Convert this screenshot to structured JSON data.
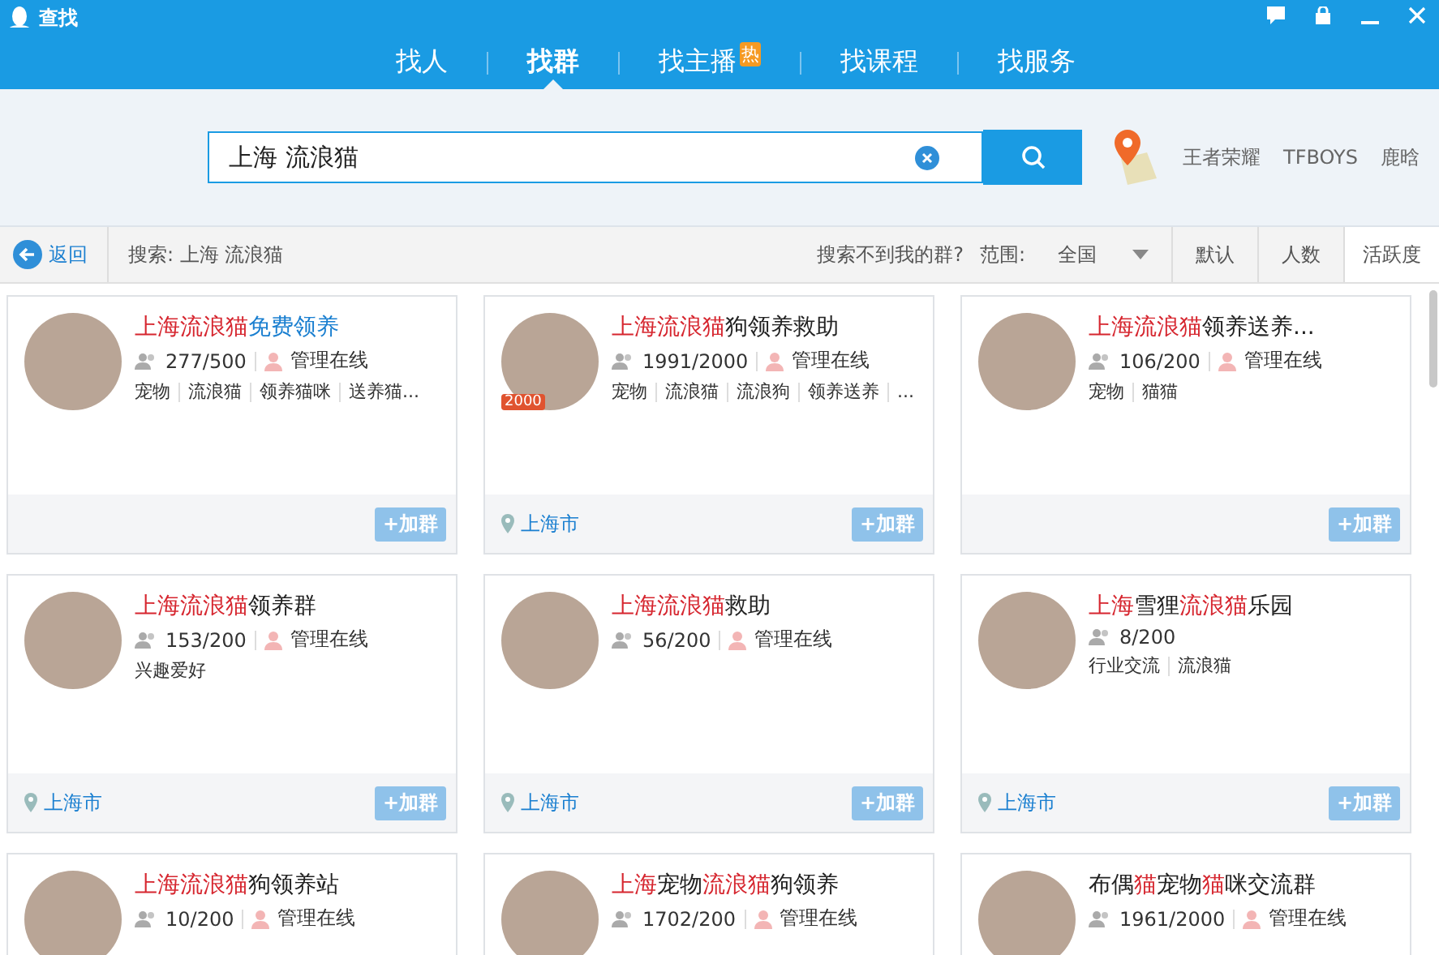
{
  "window": {
    "title": "查找"
  },
  "nav_tabs": [
    {
      "label": "找人",
      "selected": false
    },
    {
      "label": "找群",
      "selected": true
    },
    {
      "label": "找主播",
      "selected": false,
      "badge": "热"
    },
    {
      "label": "找课程",
      "selected": false
    },
    {
      "label": "找服务",
      "selected": false
    }
  ],
  "search": {
    "value": "上海 流浪猫"
  },
  "hot_keywords": [
    "王者荣耀",
    "TFBOYS",
    "鹿晗"
  ],
  "filter_bar": {
    "back": "返回",
    "query_label": "搜索: 上海 流浪猫",
    "help_link": "搜索不到我的群?",
    "range_label": "范围:",
    "range_value": "全国",
    "sort_options": [
      {
        "label": "默认",
        "selected": false
      },
      {
        "label": "人数",
        "selected": false
      },
      {
        "label": "活跃度",
        "selected": true
      }
    ]
  },
  "groups": [
    {
      "title_parts": [
        {
          "text": "上海流浪猫",
          "kind": "match"
        },
        {
          "text": "免费领养",
          "kind": "link"
        }
      ],
      "members": "277/500",
      "admin": "管理在线",
      "tags": [
        "宠物",
        "流浪猫",
        "领养猫咪",
        "送养猫..."
      ],
      "join": "+加群"
    },
    {
      "title_parts": [
        {
          "text": "上海流浪猫",
          "kind": "match"
        },
        {
          "text": "狗领养救助",
          "kind": "plain"
        }
      ],
      "badge": "2000",
      "members": "1991/2000",
      "admin": "管理在线",
      "tags": [
        "宠物",
        "流浪猫",
        "流浪狗",
        "领养送养",
        "..."
      ],
      "location": "上海市",
      "join": "+加群"
    },
    {
      "title_parts": [
        {
          "text": "上海流浪猫",
          "kind": "match"
        },
        {
          "text": "领养送养...",
          "kind": "plain"
        }
      ],
      "members": "106/200",
      "admin": "管理在线",
      "tags": [
        "宠物",
        "猫猫"
      ],
      "join": "+加群"
    },
    {
      "title_parts": [
        {
          "text": "上海流浪猫",
          "kind": "match"
        },
        {
          "text": "领养群",
          "kind": "plain"
        }
      ],
      "members": "153/200",
      "admin": "管理在线",
      "tags": [
        "兴趣爱好"
      ],
      "location": "上海市",
      "join": "+加群"
    },
    {
      "title_parts": [
        {
          "text": "上海流浪猫",
          "kind": "match"
        },
        {
          "text": "救助",
          "kind": "plain"
        }
      ],
      "members": "56/200",
      "admin": "管理在线",
      "location": "上海市",
      "join": "+加群"
    },
    {
      "title_parts": [
        {
          "text": "上海",
          "kind": "match"
        },
        {
          "text": "雪狸",
          "kind": "plain"
        },
        {
          "text": "流浪猫",
          "kind": "match"
        },
        {
          "text": "乐园",
          "kind": "plain"
        }
      ],
      "members": "8/200",
      "tags": [
        "行业交流",
        "流浪猫"
      ],
      "location": "上海市",
      "join": "+加群"
    },
    {
      "title_parts": [
        {
          "text": "上海流浪猫",
          "kind": "match"
        },
        {
          "text": "狗领养站",
          "kind": "plain"
        }
      ],
      "members": "10/200",
      "admin": "管理在线"
    },
    {
      "title_parts": [
        {
          "text": "上海",
          "kind": "match"
        },
        {
          "text": "宠物",
          "kind": "plain"
        },
        {
          "text": "流浪猫",
          "kind": "match"
        },
        {
          "text": "狗领养",
          "kind": "plain"
        }
      ],
      "members": "1702/200",
      "admin": "管理在线"
    },
    {
      "title_parts": [
        {
          "text": "布偶",
          "kind": "plain"
        },
        {
          "text": "猫",
          "kind": "match"
        },
        {
          "text": "宠物",
          "kind": "plain"
        },
        {
          "text": "猫",
          "kind": "match"
        },
        {
          "text": "咪交流群",
          "kind": "plain"
        }
      ],
      "members": "1961/2000",
      "admin": "管理在线"
    }
  ]
}
